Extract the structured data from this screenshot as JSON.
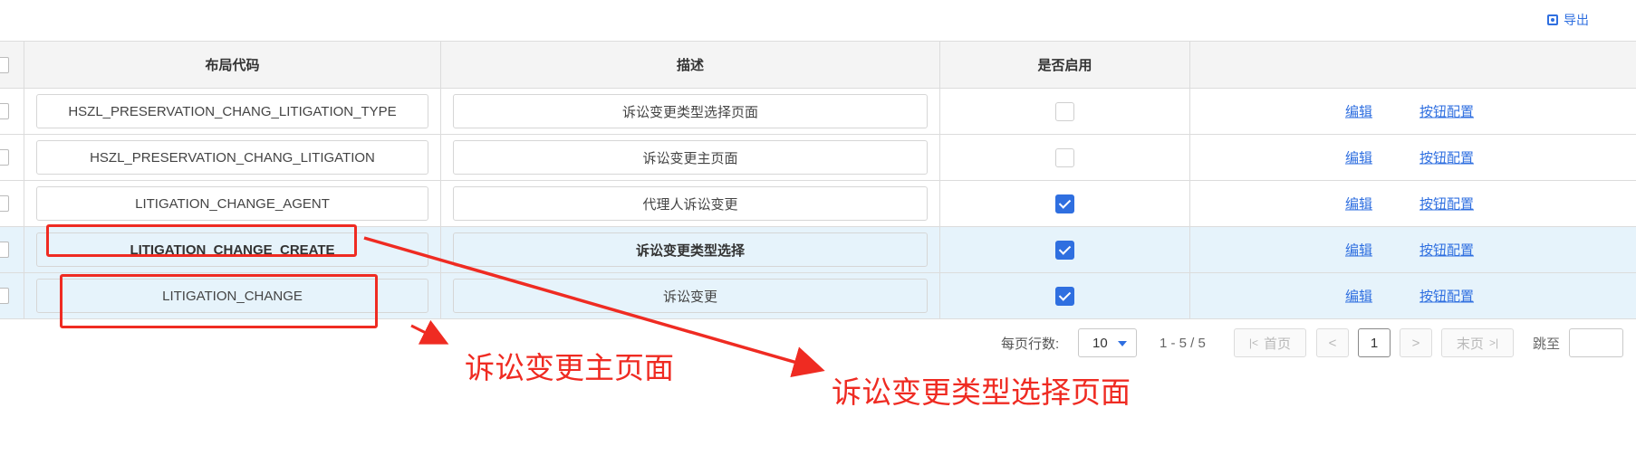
{
  "toolbar": {
    "export_label": "导出"
  },
  "table": {
    "headers": {
      "layout_code": "布局代码",
      "description": "描述",
      "enabled": "是否启用",
      "ops": ""
    },
    "rows": [
      {
        "code": "HSZL_PRESERVATION_CHANG_LITIGATION_TYPE",
        "desc": "诉讼变更类型选择页面",
        "enabled": false,
        "edit": "编辑",
        "button_config": "按钮配置"
      },
      {
        "code": "HSZL_PRESERVATION_CHANG_LITIGATION",
        "desc": "诉讼变更主页面",
        "enabled": false,
        "edit": "编辑",
        "button_config": "按钮配置"
      },
      {
        "code": "LITIGATION_CHANGE_AGENT",
        "desc": "代理人诉讼变更",
        "enabled": true,
        "edit": "编辑",
        "button_config": "按钮配置"
      },
      {
        "code": "LITIGATION_CHANGE_CREATE",
        "desc": "诉讼变更类型选择",
        "enabled": true,
        "edit": "编辑",
        "button_config": "按钮配置"
      },
      {
        "code": "LITIGATION_CHANGE",
        "desc": "诉讼变更",
        "enabled": true,
        "edit": "编辑",
        "button_config": "按钮配置"
      }
    ]
  },
  "pagination": {
    "rows_per_page_label": "每页行数:",
    "rows_per_page": "10",
    "range": "1 - 5 / 5",
    "first": "首页",
    "prev": "<",
    "current": "1",
    "next": ">",
    "last": "末页",
    "jump_label": "跳至"
  },
  "annotations": {
    "main_page": "诉讼变更主页面",
    "type_select_page": "诉讼变更类型选择页面",
    "color": "#ef2b22"
  },
  "colors": {
    "accent": "#2f6fe0",
    "highlight_row": "#e6f3fb"
  }
}
